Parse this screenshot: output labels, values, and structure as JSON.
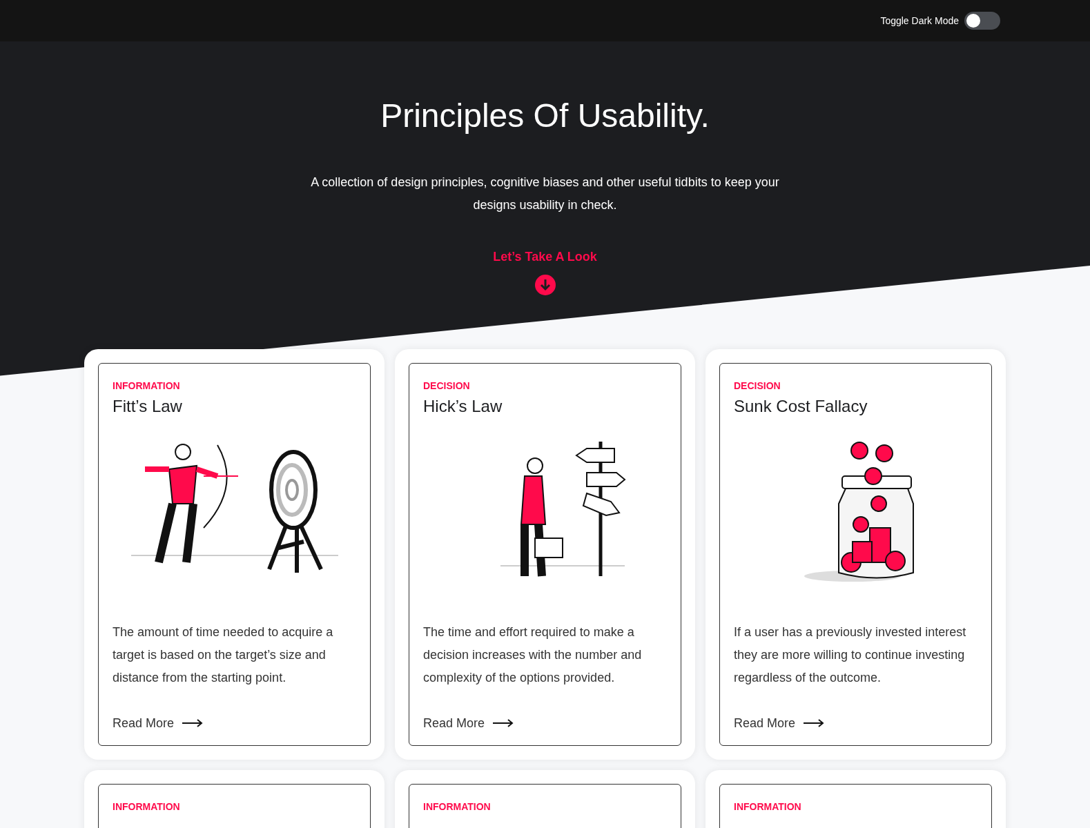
{
  "topbar": {
    "toggle": {
      "label": "Toggle Dark Mode",
      "on": false
    }
  },
  "hero": {
    "title": "Principles Of Usability.",
    "subtitle": "A collection of design principles, cognitive biases and other useful tidbits to keep your designs usability in check.",
    "cta": "Let’s Take A Look"
  },
  "cards": [
    {
      "category": "INFORMATION",
      "title": "Fitt’s Law",
      "kind": "archer",
      "description": "The amount of time needed to acquire a target is based on the target’s size and distance from the starting point.",
      "link": "Read More"
    },
    {
      "category": "DECISION",
      "title": "Hick’s Law",
      "kind": "signpost",
      "description": "The time and effort required to make a decision increases with the number and complexity of the options provided.",
      "link": "Read More"
    },
    {
      "category": "DECISION",
      "title": "Sunk Cost Fallacy",
      "kind": "jar",
      "description": "If a user has a previously invested interest they are more willing to continue investing regardless of the outcome.",
      "link": "Read More"
    },
    {
      "category": "INFORMATION"
    },
    {
      "category": "INFORMATION"
    },
    {
      "category": "INFORMATION"
    }
  ]
}
